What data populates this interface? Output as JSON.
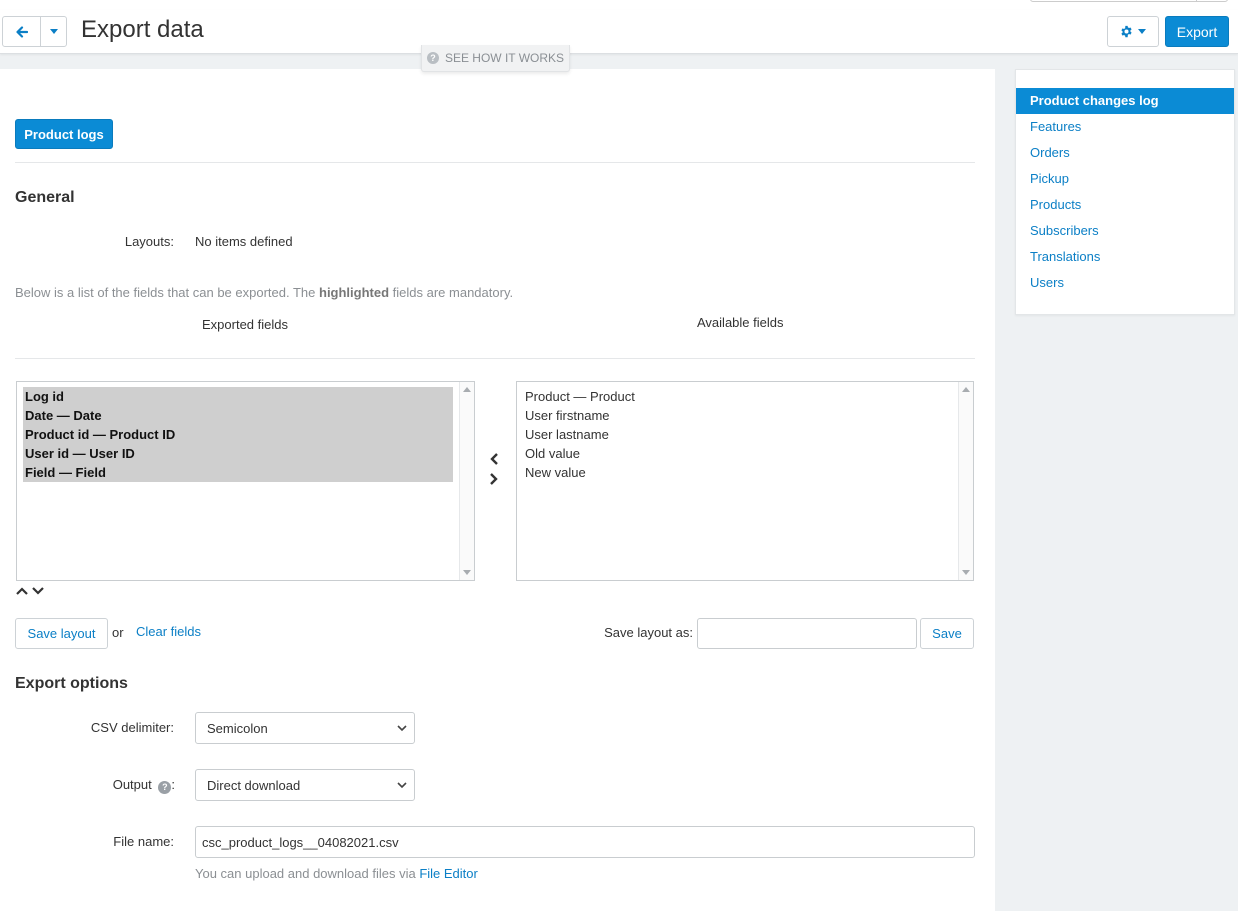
{
  "header": {
    "title": "Export data",
    "export_label": "Export",
    "how_it_works": "SEE HOW IT WORKS"
  },
  "sidebar": {
    "items": [
      {
        "label": "Product changes log",
        "active": true
      },
      {
        "label": "Features"
      },
      {
        "label": "Orders"
      },
      {
        "label": "Pickup"
      },
      {
        "label": "Products"
      },
      {
        "label": "Subscribers"
      },
      {
        "label": "Translations"
      },
      {
        "label": "Users"
      }
    ]
  },
  "main": {
    "tab_label": "Product logs",
    "general_title": "General",
    "layouts_label": "Layouts:",
    "layouts_value": "No items defined",
    "fields_note_before": "Below is a list of the fields that can be exported. The ",
    "fields_note_bold": "highlighted",
    "fields_note_after": " fields are mandatory.",
    "exported_fields_title": "Exported fields",
    "available_fields_title": "Available fields",
    "exported_fields": [
      "Log id",
      "Date — Date",
      "Product id — Product ID",
      "User id — User ID",
      "Field — Field"
    ],
    "available_fields": [
      "Product — Product",
      "User firstname",
      "User lastname",
      "Old value",
      "New value"
    ],
    "save_layout_label": "Save layout",
    "or_text": "or",
    "clear_fields_label": "Clear fields",
    "save_layout_as_label": "Save layout as:",
    "save_layout_as_value": "",
    "save_label": "Save",
    "export_options_title": "Export options",
    "csv_delimiter_label": "CSV delimiter:",
    "csv_delimiter_value": "Semicolon",
    "output_label": "Output",
    "output_colon": ":",
    "output_value": "Direct download",
    "file_name_label": "File name:",
    "file_name_value": "csc_product_logs__04082021.csv",
    "file_hint_before": "You can upload and download files via ",
    "file_hint_link": "File Editor"
  },
  "colors": {
    "accent": "#0b8bd5",
    "link": "#0b7fc6",
    "highlight": "#cfcfcf"
  }
}
